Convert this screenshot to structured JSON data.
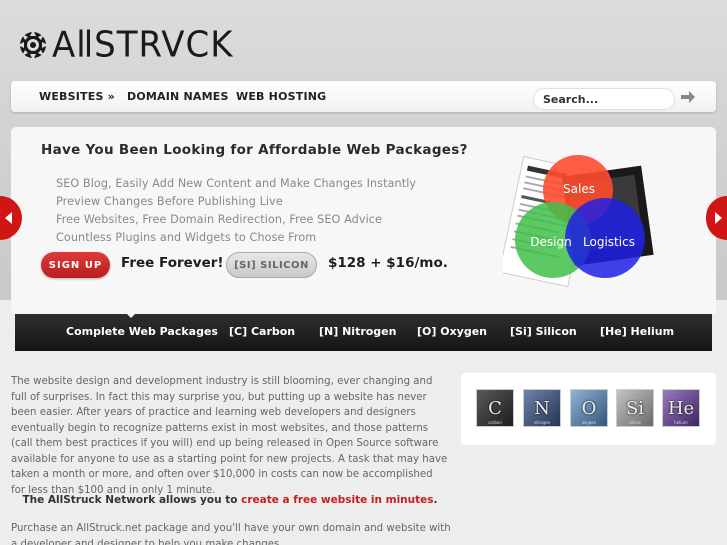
{
  "brand": {
    "name": "AllStruck",
    "logo_icon": "gear-flower-icon"
  },
  "nav": {
    "items": [
      {
        "label": "WEBSITES »"
      },
      {
        "label": "DOMAIN NAMES"
      },
      {
        "label": "WEB HOSTING"
      }
    ],
    "search_placeholder": "Search...",
    "search_icon": "arrow-right-icon"
  },
  "hero": {
    "title": "Have You Been Looking for Affordable Web Packages?",
    "features": [
      "SEO Blog, Easily Add New Content and Make Changes Instantly",
      "Preview Changes Before Publishing Live",
      "Free Websites, Free Domain Redirection, Free SEO Advice",
      "Countless Plugins and Widgets to Chose From"
    ],
    "signup_label": "SIGN UP",
    "free_label": "Free Forever!",
    "silicon_label": "[SI] SILICON",
    "price": "$128 + $16/mo.",
    "venn": {
      "sales": "Sales",
      "design": "Design",
      "logistics": "Logistics"
    },
    "colors": {
      "accent": "#d11414",
      "sales": "#ff5a2b",
      "design": "#4caf50",
      "logistics": "#2e2ee6"
    }
  },
  "tabs": [
    {
      "label": "Complete Web Packages"
    },
    {
      "label": "[C] Carbon"
    },
    {
      "label": "[N] Nitrogen"
    },
    {
      "label": "[O] Oxygen"
    },
    {
      "label": "[Si] Silicon"
    },
    {
      "label": "[He] Helium"
    }
  ],
  "main": {
    "intro": "The website design and development industry is still blooming, ever changing and full of surprises. In fact this may surprise you, but putting up a website has never been easier. After years of practice and learning web developers and designers eventually begin to recognize patterns exist in most websites, and those patterns (call them best practices if you will) end up being released in Open Source software available for anyone to use as a starting point for new projects. A task that may have taken a month or more, and often over $10,000 in costs can now be accomplished for less than $100 and in only 1 minute.",
    "network_prefix": "The AllStruck Network allows you to ",
    "network_link": "create a free website in minutes",
    "network_suffix": ".",
    "purchase": "Purchase an AllStruck.net package and you'll have your own domain and website with a developer and designer to help you make changes."
  },
  "elements": [
    {
      "symbol": "C",
      "name": "carbon",
      "color": "#3a3a3a"
    },
    {
      "symbol": "N",
      "name": "nitrogen",
      "color": "#3e4f72"
    },
    {
      "symbol": "O",
      "name": "oxygen",
      "color": "#4a6e96"
    },
    {
      "symbol": "Si",
      "name": "silicon",
      "color": "#8a8a8a"
    },
    {
      "symbol": "He",
      "name": "helium",
      "color": "#5a3f7a"
    }
  ]
}
